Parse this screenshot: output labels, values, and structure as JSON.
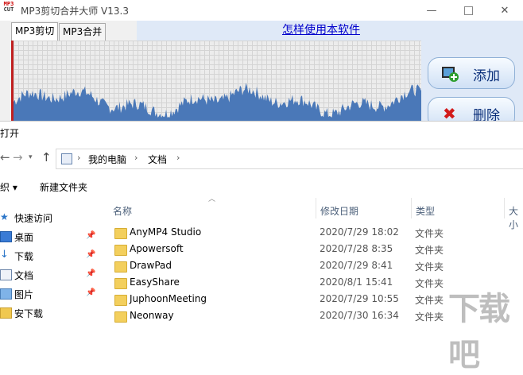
{
  "app": {
    "logo_top": "MP3",
    "logo_bottom": "CUT",
    "title": "MP3剪切合并大师 V13.3",
    "tabs": [
      "MP3剪切",
      "MP3合并"
    ],
    "help_link": "怎样使用本软件",
    "add_button": "添加",
    "delete_button": "删除",
    "delete_glyph": "✖"
  },
  "dialog": {
    "title": "打开",
    "nav_back": "←",
    "nav_forward": "→",
    "nav_caret": "▾",
    "nav_up": "↑",
    "breadcrumb": [
      "我的电脑",
      "文档"
    ],
    "breadcrumb_sep": "›",
    "toolbar": {
      "organize": "织 ▾",
      "new_folder": "新建文件夹"
    },
    "nav_items": [
      {
        "label": "快速访问",
        "icon": "star-icon",
        "pinned": false
      },
      {
        "label": "桌面",
        "icon": "desktop-icon",
        "pinned": true
      },
      {
        "label": "下载",
        "icon": "download-icon",
        "pinned": true
      },
      {
        "label": "文档",
        "icon": "documents-icon",
        "pinned": true
      },
      {
        "label": "图片",
        "icon": "pictures-icon",
        "pinned": true
      },
      {
        "label": "安下载",
        "icon": "folder-icon",
        "pinned": false
      }
    ],
    "pin_glyph": "📌",
    "columns": {
      "name": "名称",
      "date": "修改日期",
      "type": "类型",
      "size": "大小"
    },
    "files": [
      {
        "name": "AnyMP4 Studio",
        "date": "2020/7/29 18:02",
        "type": "文件夹"
      },
      {
        "name": "Apowersoft",
        "date": "2020/7/28 8:35",
        "type": "文件夹"
      },
      {
        "name": "DrawPad",
        "date": "2020/7/29 8:41",
        "type": "文件夹"
      },
      {
        "name": "EasyShare",
        "date": "2020/8/1 15:41",
        "type": "文件夹"
      },
      {
        "name": "JuphoonMeeting",
        "date": "2020/7/29 10:55",
        "type": "文件夹"
      },
      {
        "name": "Neonway",
        "date": "2020/7/30 16:34",
        "type": "文件夹"
      }
    ]
  },
  "watermark": "下载吧"
}
